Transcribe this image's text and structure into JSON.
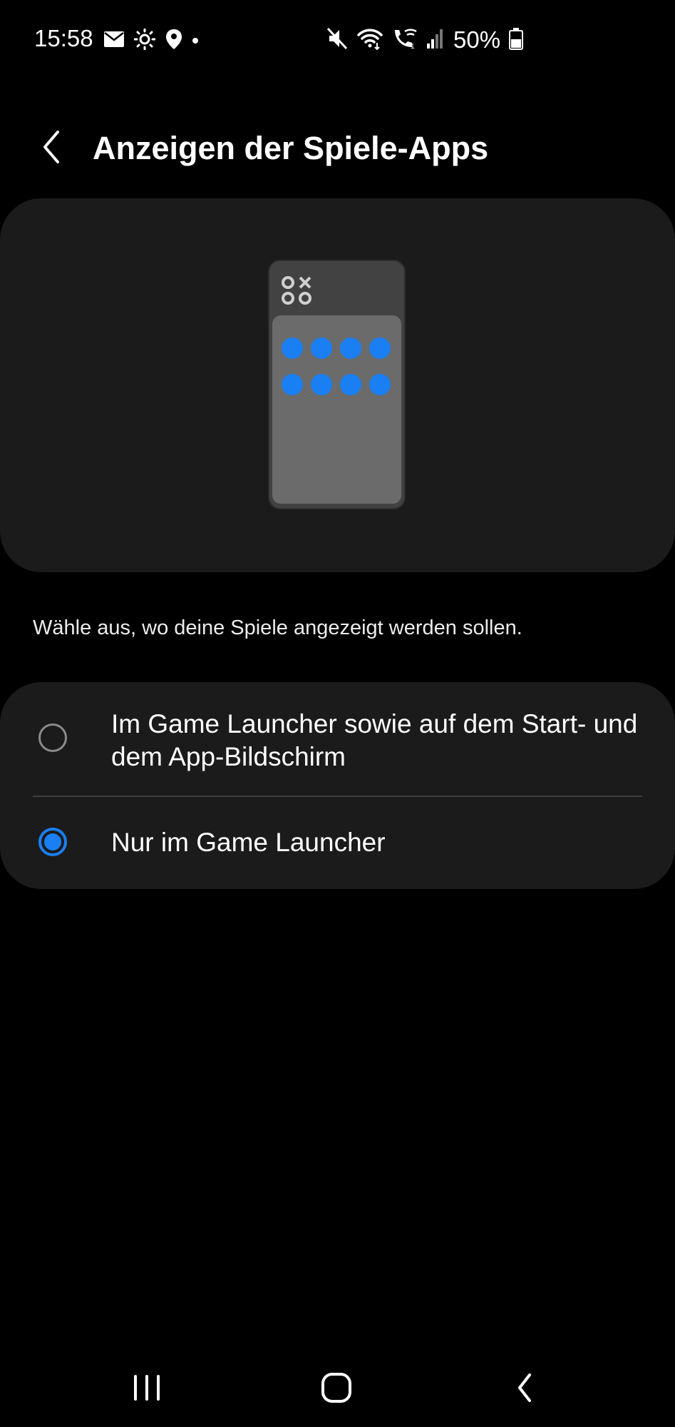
{
  "status_bar": {
    "time": "15:58",
    "battery": "50%",
    "left_icons": [
      "mail-icon",
      "brightness-icon",
      "location-icon",
      "notification-dot"
    ],
    "right_icons": [
      "mute-icon",
      "wifi-icon",
      "wifi-calling-icon",
      "signal-icon",
      "battery-icon"
    ]
  },
  "header": {
    "title": "Anzeigen der Spiele-Apps",
    "back_icon": "chevron-left-icon"
  },
  "illustration": {
    "icon": "game-launcher-phone-illustration",
    "dot_color": "#1a7ff2"
  },
  "description": "Wähle aus, wo deine Spiele angezeigt werden sollen.",
  "options": [
    {
      "label": "Im Game Launcher sowie auf dem Start- und dem App-Bildschirm",
      "selected": false
    },
    {
      "label": "Nur im Game Launcher",
      "selected": true
    }
  ],
  "nav_bar": {
    "icons": [
      "recent-apps-icon",
      "home-icon",
      "back-icon"
    ]
  },
  "colors": {
    "background": "#000000",
    "card": "#1b1b1b",
    "accent": "#1a7ff2"
  }
}
